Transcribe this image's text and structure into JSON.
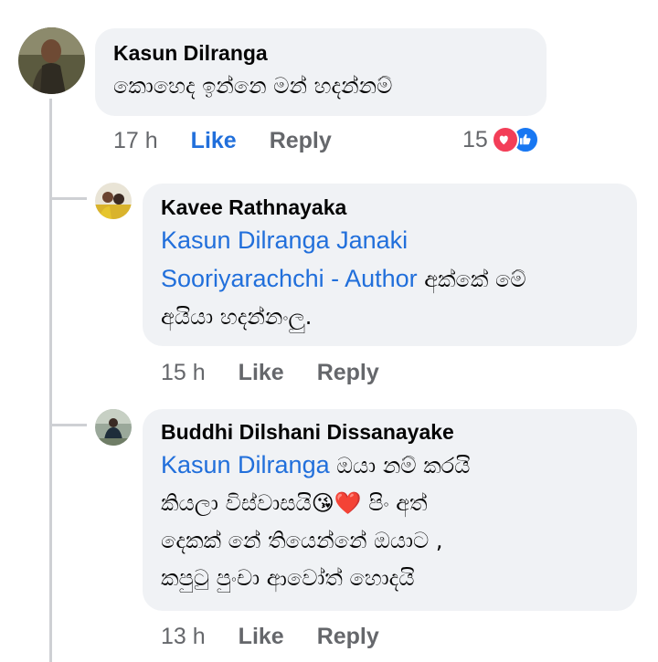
{
  "colors": {
    "like_blue": "#216fdb",
    "heart_red": "#f33e58",
    "bubble_bg": "#f0f2f5",
    "meta_gray": "#65676b"
  },
  "comment": {
    "author": "Kasun Dilranga",
    "text": "කොහෙද ඉන්නෙ මන් හදන්නම්",
    "time": "17 h",
    "like_label": "Like",
    "reply_label": "Reply",
    "reaction_count": "15",
    "reaction_icons": [
      "love-reaction-icon",
      "like-reaction-icon"
    ]
  },
  "replies": [
    {
      "author": "Kavee Rathnayaka",
      "mention_line1": "Kasun Dilranga Janaki",
      "mention_line2": "Sooriyarachchi - Author",
      "text_line2": " අක්කේ මේ",
      "text_line3": "අයියා හදන්නංලු.",
      "time": "15 h",
      "like_label": "Like",
      "reply_label": "Reply"
    },
    {
      "author": "Buddhi Dilshani Dissanayake",
      "mention": "Kasun Dilranga",
      "text_line1": " ඔයා නම් කරයි",
      "text_line2": "කියලා විස්වාසයි",
      "emoji": "😘❤️",
      "text_line2b": " පිං අත්",
      "text_line3": "දෙකක් නේ තියෙන්නේ ඔයාට ,",
      "text_line4": "කපුටු පුංචා ආවෝත් හොදයි",
      "time": "13 h",
      "like_label": "Like",
      "reply_label": "Reply"
    }
  ]
}
